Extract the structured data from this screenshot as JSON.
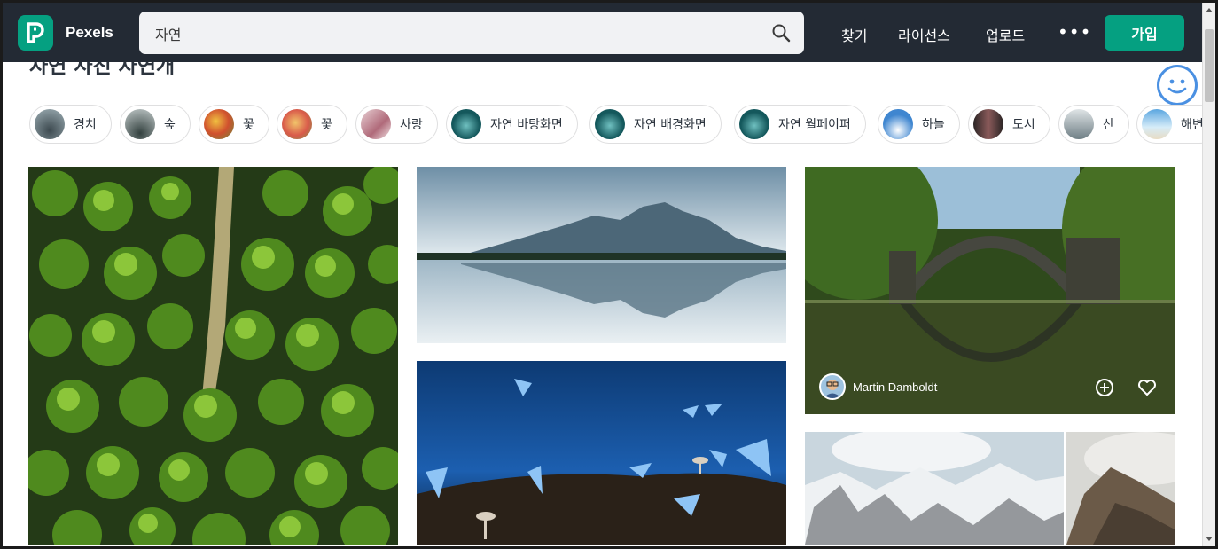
{
  "header": {
    "brand": "Pexels",
    "search_value": "자연",
    "nav": [
      "찾기",
      "라이선스",
      "업로드"
    ],
    "more": "•••",
    "join_label": "가입"
  },
  "page_title": "자연 사진 자연개",
  "chips": [
    {
      "label": "경치",
      "thumb": "#6b7d86"
    },
    {
      "label": "숲",
      "thumb": "#7e8c8b"
    },
    {
      "label": "꽃",
      "thumb": "#d98a4c"
    },
    {
      "label": "꽃",
      "thumb": "#d97a64"
    },
    {
      "label": "사랑",
      "thumb": "#c9a0a6"
    },
    {
      "label": "자연 바탕화면",
      "thumb": "#1e6b6e"
    },
    {
      "label": "자연 배경화면",
      "thumb": "#1e6b6e"
    },
    {
      "label": "자연 월페이퍼",
      "thumb": "#1e6b6e"
    },
    {
      "label": "하늘",
      "thumb": "#3f86d0"
    },
    {
      "label": "도시",
      "thumb": "#5a4040"
    },
    {
      "label": "산",
      "thumb": "#8a9aa0"
    },
    {
      "label": "해변",
      "thumb": "#9fc9e8"
    }
  ],
  "photos": {
    "forest": {
      "alt": "aerial forest"
    },
    "lake": {
      "alt": "mountain lake reflection"
    },
    "bridge": {
      "photographer": "Martin Damboldt"
    },
    "butterflies": {
      "alt": "blue butterflies"
    },
    "snow": {
      "alt": "snowy mountains"
    },
    "cliff": {
      "alt": "rocky peak"
    }
  },
  "colors": {
    "header_bg": "#232a34",
    "brand_green": "#05a081"
  }
}
